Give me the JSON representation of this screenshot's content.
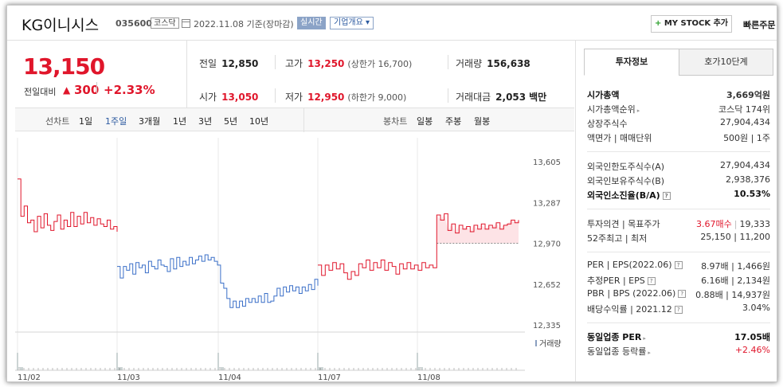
{
  "header": {
    "company": "KG이니시스",
    "code": "035600",
    "market": "코스닥",
    "date_text": "2022.11.08  기준(장마감)",
    "live_badge": "실시간",
    "info_badge": "기업개요",
    "mystock_button": "MY STOCK 추가",
    "quick_order": "빠른주문"
  },
  "price": {
    "current": "13,150",
    "change_label": "전일대비",
    "change_value": "300",
    "change_pct": "+2.33%",
    "up_color": "#e0162b"
  },
  "stats": {
    "prev_close_label": "전일",
    "prev_close": "12,850",
    "high_label": "고가",
    "high": "13,250",
    "upper_limit": "(상한가 16,700)",
    "volume_label": "거래량",
    "volume": "156,638",
    "open_label": "시가",
    "open": "13,050",
    "low_label": "저가",
    "low": "12,950",
    "lower_limit": "(하한가 9,000)",
    "amount_label": "거래대금",
    "amount": "2,053",
    "amount_unit": "백만"
  },
  "period_bar": {
    "line_label": "선차트",
    "line_items": [
      "1일",
      "1주일",
      "3개월",
      "1년",
      "3년",
      "5년",
      "10년"
    ],
    "active_line": "1주일",
    "candle_label": "봉차트",
    "candle_items": [
      "일봉",
      "주봉",
      "월봉"
    ]
  },
  "chart_data": {
    "type": "line",
    "yticks": [
      "13,605",
      "13,287",
      "12,970",
      "12,652",
      "12,335"
    ],
    "ylim": [
      12335,
      13605
    ],
    "x_labels": [
      "11/02",
      "11/03",
      "11/04",
      "11/07",
      "11/08"
    ],
    "volume_label": "거래량",
    "reference_price": 12850,
    "series": [
      {
        "color": "#e0162b",
        "values": [
          13470,
          13180,
          13260,
          13130,
          13150,
          13060,
          13180,
          13090,
          13200,
          13110,
          13070,
          13140,
          13190,
          13080,
          13150,
          13100,
          13210,
          13100,
          13180,
          13120,
          13210,
          13130,
          13170,
          13110,
          13160,
          13120,
          13100,
          13150,
          13080,
          13100,
          13060
        ]
      },
      {
        "color": "#3a6fc8",
        "values": [
          12790,
          12700,
          12790,
          12760,
          12810,
          12730,
          12820,
          12780,
          12800,
          12740,
          12830,
          12790,
          12770,
          12840,
          12800,
          12790,
          12750,
          12850,
          12770,
          12860,
          12790,
          12830,
          12800,
          12860,
          12810,
          12840,
          12870,
          12830,
          12880,
          12840,
          12860,
          12830,
          12800,
          12660,
          12620,
          12540,
          12470,
          12520,
          12470,
          12520,
          12480,
          12540,
          12510,
          12540,
          12510,
          12560,
          12510,
          12580,
          12510,
          12520,
          12560,
          12620,
          12560,
          12630,
          12590,
          12640,
          12600,
          12630,
          12580,
          12630,
          12600,
          12650,
          12610,
          12690,
          12640
        ]
      },
      {
        "color": "#e0162b",
        "values": [
          12800,
          12720,
          12800,
          12760,
          12820,
          12770,
          12810,
          12740,
          12690,
          12750,
          12720,
          12810,
          12780,
          12840,
          12760,
          12820,
          12780,
          12840,
          12760,
          12820,
          12790,
          12730,
          12810,
          12770,
          12820,
          12770,
          12800,
          12760,
          12820,
          12780,
          12800,
          12780,
          13190,
          13150,
          13200,
          13070,
          13120,
          13050,
          13110,
          13080,
          13100,
          13060,
          13110,
          13080,
          13120,
          13080,
          13110,
          13090,
          13130,
          13080,
          13110,
          13120,
          13150,
          13130,
          13150
        ]
      }
    ]
  },
  "panel": {
    "tab_active": "투자정보",
    "tab_inactive": "호가10단계",
    "rows": [
      {
        "k": "시가총액",
        "v": "3,669억원"
      },
      {
        "k": "시가총액순위",
        "v": "코스닥 174위"
      },
      {
        "k": "상장주식수",
        "v": "27,904,434"
      },
      {
        "k": "액면가 | 매매단위",
        "v": "500원 | 1주"
      },
      {
        "k": "외국인한도주식수(A)",
        "v": "27,904,434"
      },
      {
        "k": "외국인보유주식수(B)",
        "v": "2,938,376"
      },
      {
        "k": "외국인소진율(B/A)",
        "v": "10.53%"
      },
      {
        "k": "투자의견 | 목표주가",
        "v_up": "3.67매수",
        "v": "19,333"
      },
      {
        "k": "52주최고 | 최저",
        "v": "25,150 | 11,200"
      },
      {
        "k": "PER | EPS(2022.06)",
        "v": "8.97배 | 1,466원"
      },
      {
        "k": "추정PER | EPS",
        "v": "6.16배 | 2,134원"
      },
      {
        "k": "PBR | BPS (2022.06)",
        "v": "0.88배 | 14,937원"
      },
      {
        "k": "배당수익률 | 2021.12",
        "v": "3.04%"
      },
      {
        "k": "동일업종 PER",
        "v": "17.05배"
      },
      {
        "k": "동일업종 등락률",
        "v": "+2.46%"
      }
    ]
  }
}
